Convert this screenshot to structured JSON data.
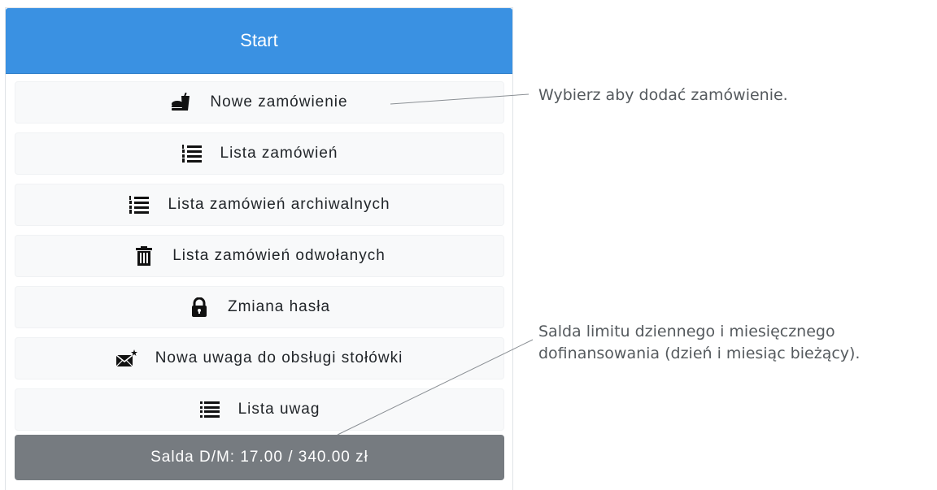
{
  "header": {
    "title": "Start"
  },
  "menu": {
    "items": [
      {
        "label": "Nowe zamówienie",
        "icon": "food-drink-icon"
      },
      {
        "label": "Lista zamówień",
        "icon": "numbered-list-icon"
      },
      {
        "label": "Lista zamówień archiwalnych",
        "icon": "numbered-list-icon"
      },
      {
        "label": "Lista zamówień odwołanych",
        "icon": "trash-icon"
      },
      {
        "label": "Zmiana hasła",
        "icon": "lock-icon"
      },
      {
        "label": "Nowa uwaga do obsługi stołówki",
        "icon": "new-mail-icon"
      },
      {
        "label": "Lista uwag",
        "icon": "list-icon"
      }
    ],
    "balance_label": "Salda D/M: 17.00 / 340.00 zł"
  },
  "annotations": {
    "new_order": "Wybierz aby dodać zamówienie.",
    "balance_line1": "Salda limitu dziennego i miesięcznego",
    "balance_line2": "dofinansowania (dzień i miesiąc bieżący)."
  },
  "colors": {
    "header_bg": "#3a91e2",
    "button_bg": "#f8f9fa",
    "balance_bg": "#767b80",
    "annotation_text": "#555a5e"
  }
}
